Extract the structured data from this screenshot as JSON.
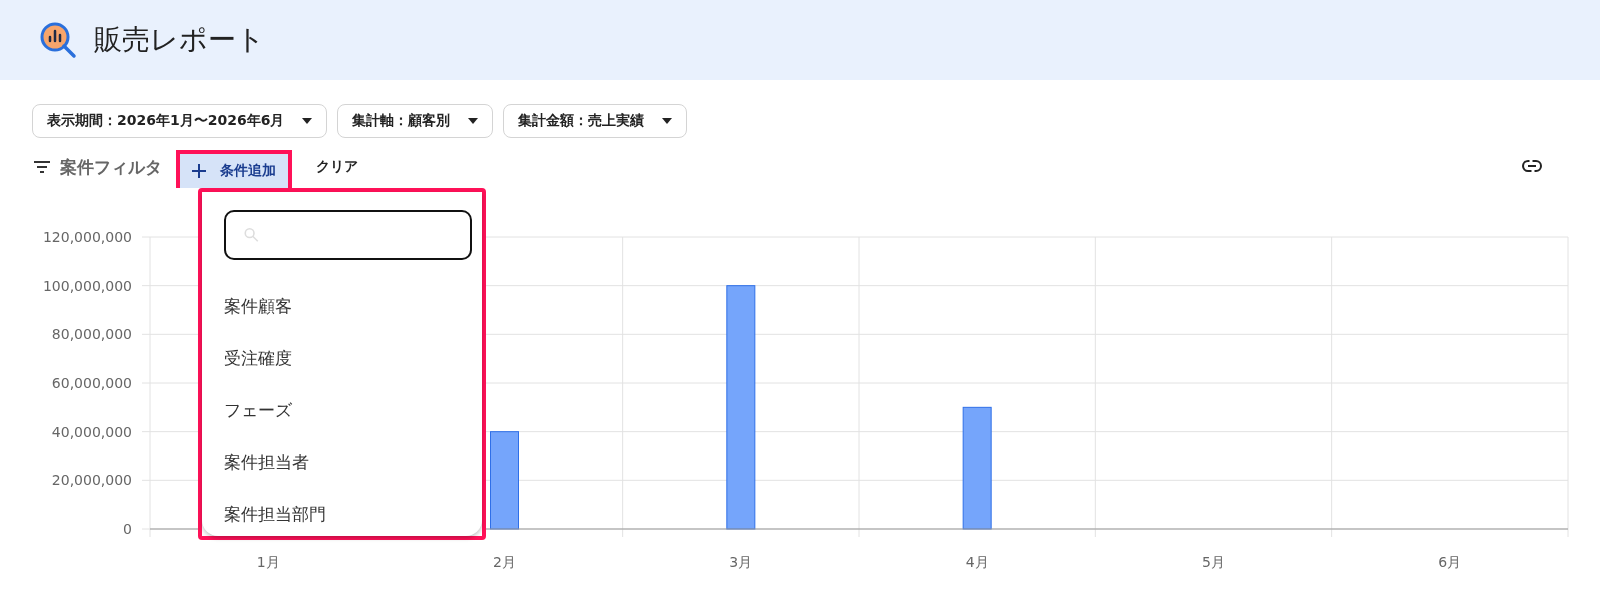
{
  "header": {
    "title": "販売レポート"
  },
  "selectors": [
    {
      "label": "表示期間：2026年1月〜2026年6月"
    },
    {
      "label": "集計軸：顧客別"
    },
    {
      "label": "集計金額：売上実績"
    }
  ],
  "filter": {
    "label": "案件フィルタ",
    "add_button": "条件追加",
    "clear_button": "クリア"
  },
  "chart_data": {
    "type": "bar",
    "categories": [
      "1月",
      "2月",
      "3月",
      "4月",
      "5月",
      "6月"
    ],
    "grid": true,
    "series": [
      {
        "color": "#75a5fb",
        "values": [
          null,
          40000000,
          100000000,
          50000000,
          0,
          0
        ]
      }
    ],
    "ylim": [
      0,
      120000000
    ],
    "yticks": [
      {
        "value": 0,
        "label": "0"
      },
      {
        "value": 20000000,
        "label": "20,000,000"
      },
      {
        "value": 40000000,
        "label": "40,000,000"
      },
      {
        "value": 60000000,
        "label": "60,000,000"
      },
      {
        "value": 80000000,
        "label": "80,000,000"
      },
      {
        "value": 100000000,
        "label": "100,000,000"
      },
      {
        "value": 120000000,
        "label": "120,000,000"
      }
    ]
  },
  "dropdown_menu": {
    "items": [
      {
        "label": "案件顧客"
      },
      {
        "label": "受注確度"
      },
      {
        "label": "フェーズ"
      },
      {
        "label": "案件担当者"
      },
      {
        "label": "案件担当部門"
      }
    ]
  }
}
